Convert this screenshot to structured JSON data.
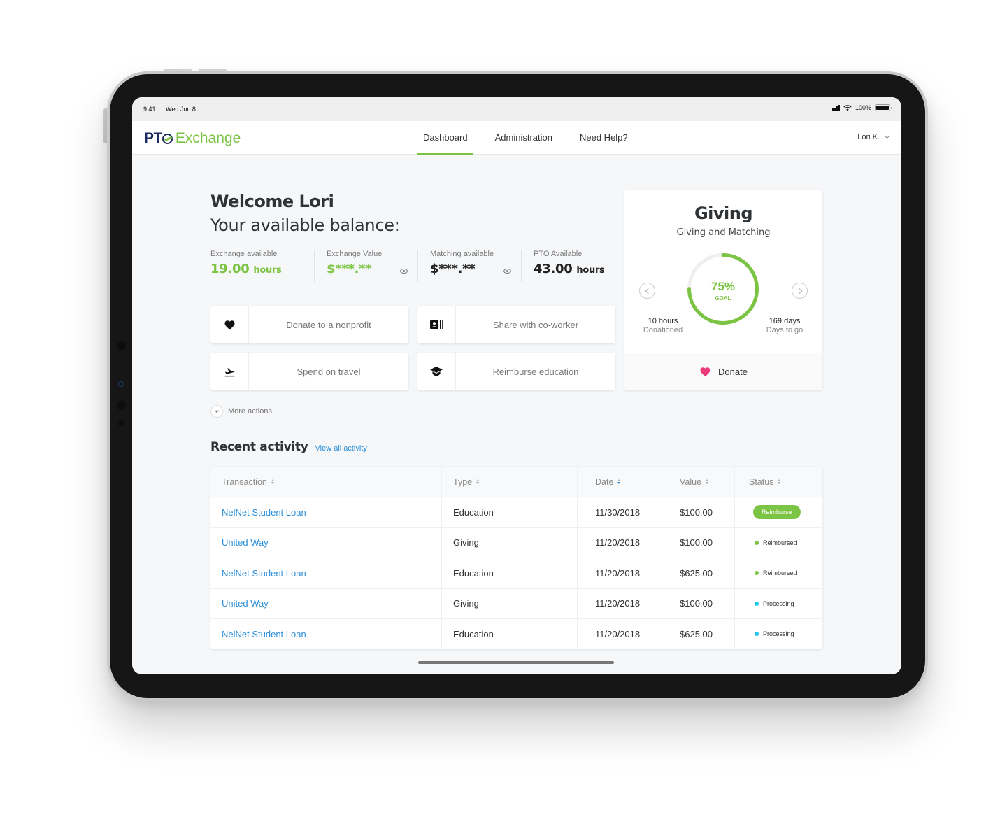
{
  "status_bar": {
    "time": "9:41",
    "date": "Wed Jun 8",
    "battery": "100%"
  },
  "brand": {
    "part1": "PT",
    "part2": "Exchange"
  },
  "nav": {
    "tabs": [
      {
        "label": "Dashboard",
        "active": true
      },
      {
        "label": "Administration",
        "active": false
      },
      {
        "label": "Need Help?",
        "active": false
      }
    ],
    "user": "Lori K."
  },
  "welcome": {
    "title": "Welcome Lori",
    "subtitle": "Your available balance:"
  },
  "balances": [
    {
      "label": "Exchange available",
      "value": "19.00",
      "unit": "hours",
      "masked": false
    },
    {
      "label": "Exchange Value",
      "value": "$***.**",
      "unit": "",
      "masked": true
    },
    {
      "label": "Matching available",
      "value": "$***.**",
      "unit": "",
      "masked": true
    },
    {
      "label": "PTO Available",
      "value": "43.00",
      "unit": "hours",
      "masked": false
    }
  ],
  "actions": [
    {
      "label": "Donate to a nonprofit",
      "icon": "heart-icon"
    },
    {
      "label": "Share with co-worker",
      "icon": "contact-card-icon"
    },
    {
      "label": "Spend on travel",
      "icon": "flight-takeoff-icon"
    },
    {
      "label": "Reimburse education",
      "icon": "graduation-cap-icon"
    }
  ],
  "more_actions": "More actions",
  "recent": {
    "title": "Recent activity",
    "link": "View all activity"
  },
  "giving": {
    "title": "Giving",
    "subtitle": "Giving and Matching",
    "progress_percent": 75,
    "progress_label": "75%",
    "goal_label": "GOAL",
    "left_stat": {
      "value": "10 hours",
      "label": "Donationed"
    },
    "right_stat": {
      "value": "169 days",
      "label": "Days to go"
    },
    "donate_label": "Donate"
  },
  "table": {
    "columns": [
      "Transaction",
      "Type",
      "Date",
      "Value",
      "Status"
    ],
    "rows": [
      {
        "transaction": "NelNet Student Loan",
        "type": "Education",
        "date": "11/30/2018",
        "value": "$100.00",
        "status": "Reimburse",
        "status_kind": "button"
      },
      {
        "transaction": "United Way",
        "type": "Giving",
        "date": "11/20/2018",
        "value": "$100.00",
        "status": "Reimbursed",
        "status_kind": "reimbursed"
      },
      {
        "transaction": "NelNet Student Loan",
        "type": "Education",
        "date": "11/20/2018",
        "value": "$625.00",
        "status": "Reimbursed",
        "status_kind": "reimbursed"
      },
      {
        "transaction": "United Way",
        "type": "Giving",
        "date": "11/20/2018",
        "value": "$100.00",
        "status": "Processing",
        "status_kind": "processing"
      },
      {
        "transaction": "NelNet Student Loan",
        "type": "Education",
        "date": "11/20/2018",
        "value": "$625.00",
        "status": "Processing",
        "status_kind": "processing"
      }
    ]
  },
  "colors": {
    "accent_green": "#7cc443",
    "brand_navy": "#1d2a63",
    "link_blue": "#2d8fd8",
    "processing_cyan": "#1ec8ea",
    "donate_pink": "#ec3a7b"
  }
}
